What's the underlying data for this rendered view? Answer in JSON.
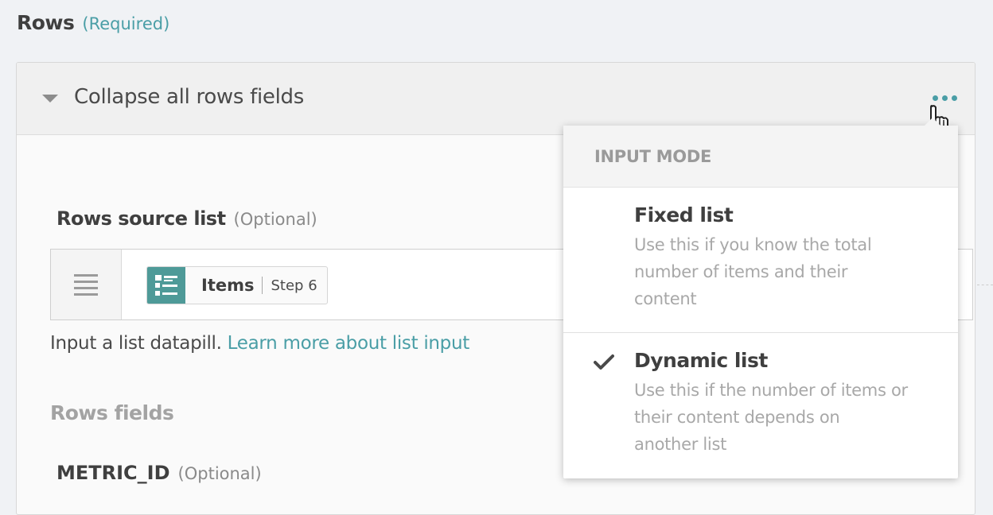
{
  "section": {
    "title": "Rows",
    "required": "(Required)"
  },
  "panel": {
    "collapse_label": "Collapse all rows fields",
    "source_list": {
      "label": "Rows source list",
      "optional": "(Optional)",
      "pill_name": "Items",
      "pill_step": "Step 6"
    },
    "help_text": "Input a list datapill.",
    "help_link": "Learn more about list input",
    "rows_fields_label": "Rows fields",
    "metric": {
      "label": "METRIC_ID",
      "optional": "(Optional)"
    }
  },
  "dropdown": {
    "header": "INPUT MODE",
    "options": [
      {
        "title": "Fixed list",
        "desc": [
          "Use this if you know the total",
          "number of items and their",
          "content"
        ],
        "selected": false
      },
      {
        "title": "Dynamic list",
        "desc": [
          "Use this if the number of items or",
          "their content depends on",
          "another list"
        ],
        "selected": true
      }
    ]
  },
  "colors": {
    "accent": "#4a9ea6",
    "pill_icon": "#4e9a98"
  },
  "icons": {
    "collapse": "caret-down-icon",
    "more": "ellipsis-icon",
    "cursor": "hand-pointer-icon",
    "mode": "list-lines-icon",
    "pill": "list-icon",
    "check": "checkmark-icon"
  }
}
